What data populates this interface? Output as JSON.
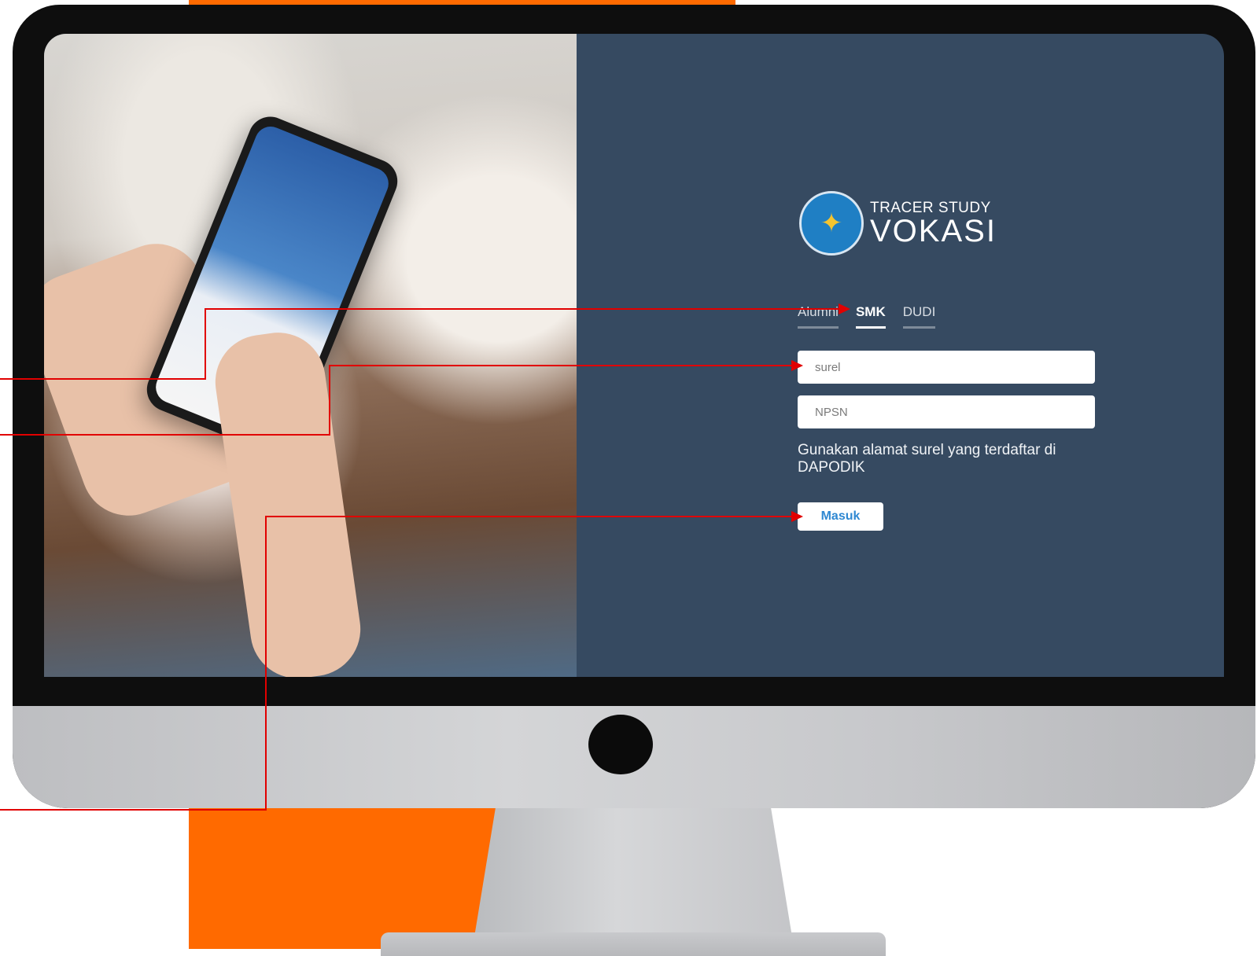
{
  "app": {
    "logo_line1": "TRACER STUDY",
    "logo_line2": "VOKASI"
  },
  "tabs": [
    {
      "label": "Alumni",
      "active": false
    },
    {
      "label": "SMK",
      "active": true
    },
    {
      "label": "DUDI",
      "active": false
    }
  ],
  "form": {
    "email_placeholder": "surel",
    "npsn_placeholder": "NPSN",
    "hint": "Gunakan alamat surel yang terdaftar di DAPODIK",
    "submit_label": "Masuk"
  },
  "colors": {
    "panel_bg": "#364a61",
    "accent_orange": "#ff6a00",
    "button_text": "#2f88d2",
    "annotation_red": "#e10000"
  }
}
